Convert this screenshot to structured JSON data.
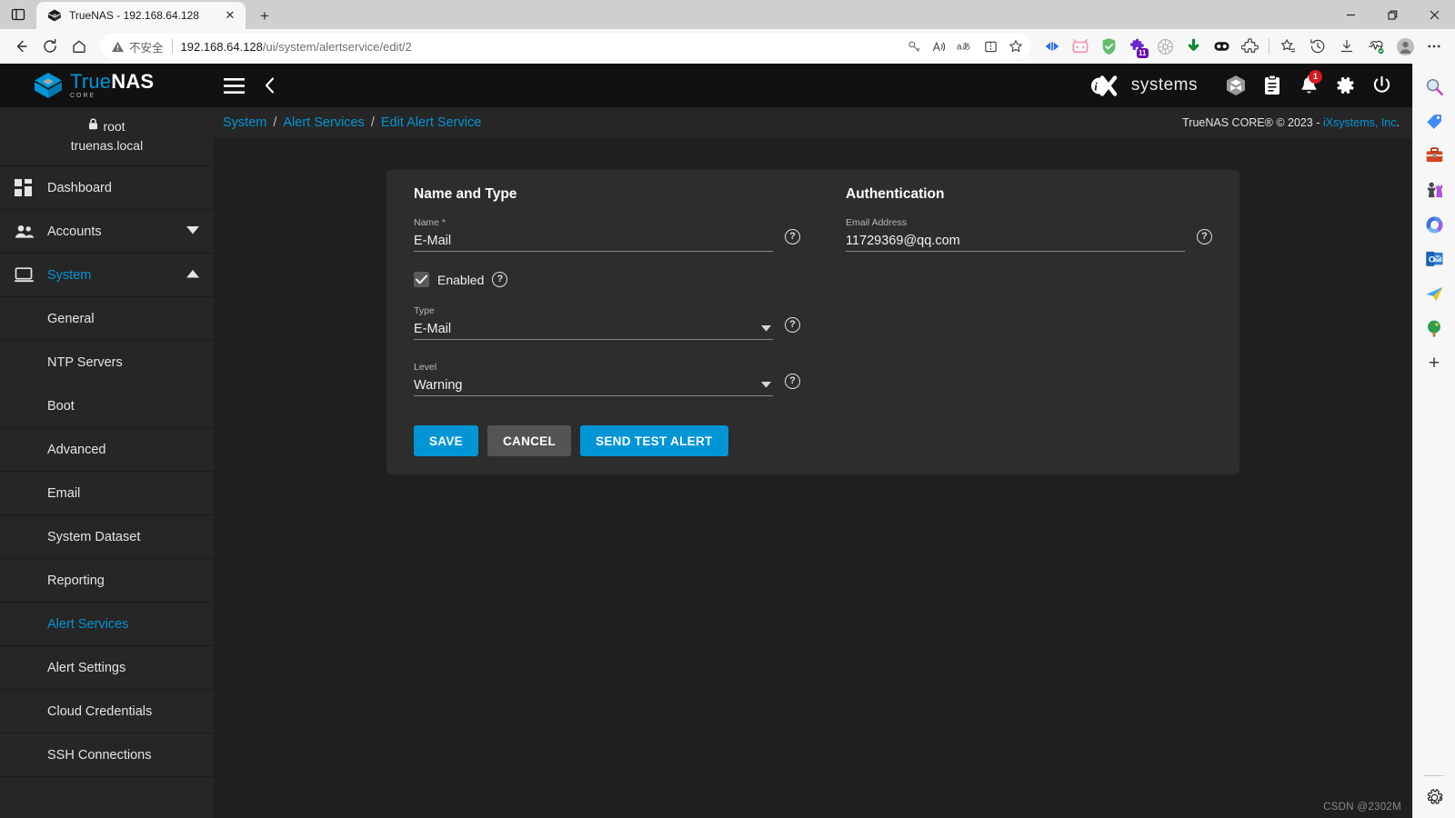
{
  "browser": {
    "tab": {
      "title": "TrueNAS - 192.168.64.128",
      "favicon_name": "truenas-favicon",
      "close_label": "✕"
    },
    "new_tab_label": "+",
    "window_controls": {
      "minimize": "—",
      "restore": "❐",
      "close": "✕"
    },
    "nav": {
      "back": "←",
      "reload": "↻",
      "home": "⌂"
    },
    "omnibox": {
      "security_text": "不安全",
      "url_host": "192.168.64.128",
      "url_path": "/ui/system/alertservice/edit/2",
      "actions": [
        "key-icon",
        "read-aloud-icon",
        "translate-icon",
        "split-screen-icon",
        "favorite-star-icon"
      ]
    },
    "extensions": [
      "video-compact-icon",
      "tv-pink-icon",
      "adguard-shield-icon",
      "puzzle-purple-icon",
      "wheel-gray-icon",
      "idm-download-icon",
      "eyes-dark-icon",
      "extensions-puzzle-icon"
    ],
    "toolbar_right": [
      "collections-icon",
      "history-icon",
      "downloads-icon",
      "browser-essentials-icon",
      "profile-avatar-icon",
      "settings-more-icon"
    ]
  },
  "truenas": {
    "logo": {
      "true": "True",
      "nas": "NAS",
      "core": "CORE"
    },
    "topbar": {
      "menu_icon": "hamburger-menu-icon",
      "back_icon": "chevron-left-icon",
      "vendor": "systems",
      "vendor_mark": "iX",
      "icons": [
        "cube-layers-icon",
        "clipboard-tasks-icon",
        "bell-notifications-icon",
        "gear-settings-icon",
        "power-icon"
      ],
      "notification_count": "1"
    },
    "sidebar": {
      "user": "root",
      "hostname": "truenas.local",
      "lock_icon": "lock-icon",
      "items": [
        {
          "label": "Dashboard",
          "icon": "dashboard-grid-icon",
          "expandable": false,
          "active": false
        },
        {
          "label": "Accounts",
          "icon": "accounts-people-icon",
          "expandable": true,
          "expanded": false,
          "active": false
        },
        {
          "label": "System",
          "icon": "system-monitor-icon",
          "expandable": true,
          "expanded": true,
          "active": true
        }
      ],
      "sub_items": [
        {
          "label": "General",
          "active": false
        },
        {
          "label": "NTP Servers",
          "active": false
        },
        {
          "label": "Boot",
          "active": false
        },
        {
          "label": "Advanced",
          "active": false
        },
        {
          "label": "Email",
          "active": false
        },
        {
          "label": "System Dataset",
          "active": false
        },
        {
          "label": "Reporting",
          "active": false
        },
        {
          "label": "Alert Services",
          "active": true
        },
        {
          "label": "Alert Settings",
          "active": false
        },
        {
          "label": "Cloud Credentials",
          "active": false
        },
        {
          "label": "SSH Connections",
          "active": false
        }
      ]
    },
    "breadcrumb": {
      "item1": "System",
      "sep1": "/",
      "item2": "Alert Services",
      "sep2": "/",
      "item3": "Edit Alert Service"
    },
    "copyright": {
      "text": "TrueNAS CORE® © 2023 - ",
      "link": "iXsystems, Inc",
      "tail": "."
    },
    "form": {
      "left_section_title": "Name and Type",
      "right_section_title": "Authentication",
      "name_label": "Name *",
      "name_value": "E-Mail",
      "enabled_label": "Enabled",
      "enabled_checked": true,
      "type_label": "Type",
      "type_value": "E-Mail",
      "level_label": "Level",
      "level_value": "Warning",
      "email_label": "Email Address",
      "email_value": "11729369@qq.com",
      "help_glyph": "?",
      "caret_glyph": "▼"
    },
    "buttons": {
      "save": "SAVE",
      "cancel": "CANCEL",
      "test": "SEND TEST ALERT"
    }
  },
  "watermark": "CSDN @2302M",
  "edgebar": {
    "icons": [
      "search-magnifier-icon",
      "shopping-tag-icon",
      "briefcase-tools-icon",
      "games-chess-icon",
      "microsoft-365-icon",
      "outlook-icon",
      "telegram-plane-icon",
      "tree-icon"
    ],
    "add_label": "+",
    "settings_icon": "gear-settings-icon"
  },
  "colors": {
    "accent": "#0095d5",
    "badge_red": "#d81920",
    "card_bg": "#2d2d2d",
    "page_bg": "#1f1f1f",
    "sidebar_bg": "#262626",
    "topbar_bg": "#111111"
  }
}
